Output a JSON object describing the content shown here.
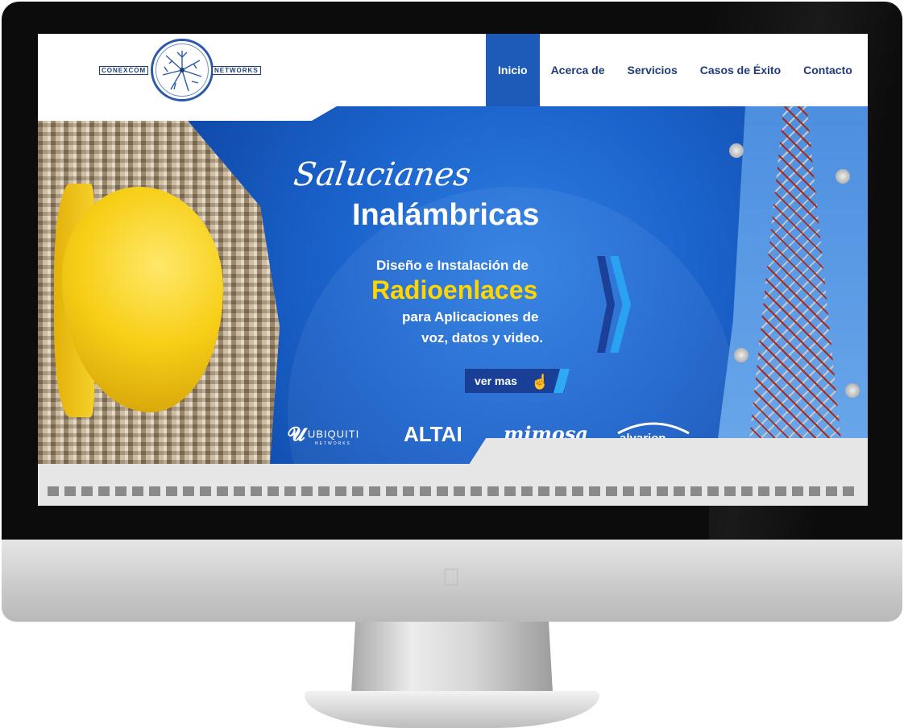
{
  "logo": {
    "left_text": "CONEXCOM",
    "right_text": "NETWORKS"
  },
  "nav": {
    "items": [
      {
        "label": "Inicio",
        "active": true
      },
      {
        "label": "Acerca de",
        "active": false
      },
      {
        "label": "Servicios",
        "active": false
      },
      {
        "label": "Casos de Éxito",
        "active": false
      },
      {
        "label": "Contacto",
        "active": false
      }
    ]
  },
  "hero": {
    "script_title": "Salucianes",
    "title": "Inalámbricas",
    "line1": "Diseño e Instalación de",
    "highlight": "Radioenlaces",
    "line3": "para Aplicaciones de",
    "line4": "voz, datos y video.",
    "cta_label": "ver mas",
    "brands": [
      "UBIQUITI",
      "ALTAI",
      "mimosa",
      "alvarion"
    ],
    "brand_sub": "NETWORKS"
  },
  "colors": {
    "nav_active": "#1e5bb8",
    "hero_blue": "#1557c0",
    "highlight_yellow": "#ffd600",
    "nav_text": "#1f3b78"
  }
}
